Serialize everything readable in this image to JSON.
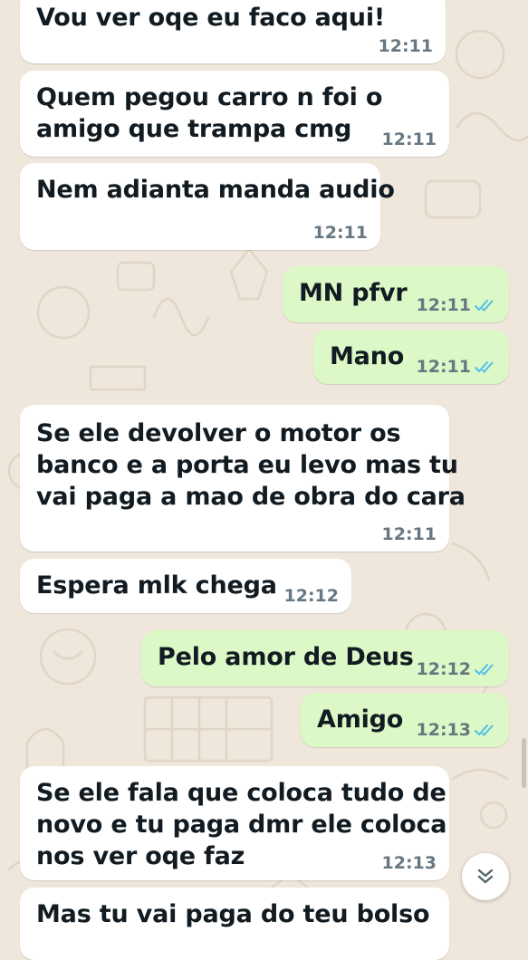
{
  "colors": {
    "background": "#efe7dc",
    "incoming_bubble": "#ffffff",
    "outgoing_bubble": "#dbf8c6",
    "read_ticks": "#53bdeb",
    "timestamp": "#667781"
  },
  "messages": [
    {
      "direction": "in",
      "lines": [
        "Vou ver oqe eu faco aqui!"
      ],
      "time": "12:11"
    },
    {
      "direction": "in",
      "lines": [
        "Quem pegou carro n foi o",
        "amigo que trampa cmg"
      ],
      "time": "12:11"
    },
    {
      "direction": "in",
      "lines": [
        "Nem adianta manda audio"
      ],
      "time": "12:11"
    },
    {
      "direction": "out",
      "lines": [
        "MN pfvr"
      ],
      "time": "12:11",
      "status": "read"
    },
    {
      "direction": "out",
      "lines": [
        "Mano"
      ],
      "time": "12:11",
      "status": "read"
    },
    {
      "direction": "in",
      "lines": [
        "Se ele devolver o motor os",
        "banco e a porta eu levo mas tu",
        "vai paga a mao de obra do cara"
      ],
      "time": "12:11"
    },
    {
      "direction": "in",
      "lines": [
        "Espera mlk chega"
      ],
      "time": "12:12"
    },
    {
      "direction": "out",
      "lines": [
        "Pelo amor de Deus"
      ],
      "time": "12:12",
      "status": "read"
    },
    {
      "direction": "out",
      "lines": [
        "Amigo"
      ],
      "time": "12:13",
      "status": "read"
    },
    {
      "direction": "in",
      "lines": [
        "Se ele fala que coloca tudo de",
        "novo e tu paga dmr ele coloca",
        "nos ver oqe faz"
      ],
      "time": "12:13"
    },
    {
      "direction": "in",
      "lines": [
        "Mas tu vai paga do teu bolso"
      ],
      "time": ""
    }
  ],
  "icons": {
    "scroll_down": "double-chevron-down-icon",
    "read_receipt": "double-check-icon"
  }
}
